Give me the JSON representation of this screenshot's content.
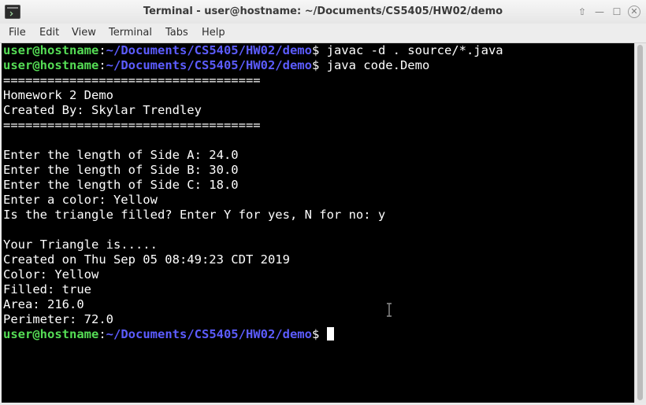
{
  "window": {
    "title": "Terminal - user@hostname: ~/Documents/CS5405/HW02/demo",
    "buttons": {
      "up": "⇧",
      "minimize": "—",
      "maximize": "☐",
      "close": "✕"
    }
  },
  "menu": {
    "items": [
      "File",
      "Edit",
      "View",
      "Terminal",
      "Tabs",
      "Help"
    ]
  },
  "prompt": {
    "user": "user@hostname",
    "sep": ":",
    "path": "~/Documents/CS5405/HW02/demo",
    "symbol": "$"
  },
  "commands": [
    " javac -d . source/*.java",
    " java code.Demo",
    " "
  ],
  "output": [
    "===================================",
    "Homework 2 Demo",
    "Created By: Skylar Trendley",
    "===================================",
    "",
    "Enter the length of Side A: 24.0",
    "Enter the length of Side B: 30.0",
    "Enter the length of Side C: 18.0",
    "Enter a color: Yellow",
    "Is the triangle filled? Enter Y for yes, N for no: y",
    "",
    "Your Triangle is.....",
    "Created on Thu Sep 05 08:49:23 CDT 2019",
    "Color: Yellow",
    "Filled: true",
    "Area: 216.0",
    "Perimeter: 72.0"
  ],
  "colors": {
    "terminal_bg": "#000000",
    "text": "#ffffff",
    "prompt_user": "#55dd55",
    "prompt_path": "#5c5cff"
  }
}
